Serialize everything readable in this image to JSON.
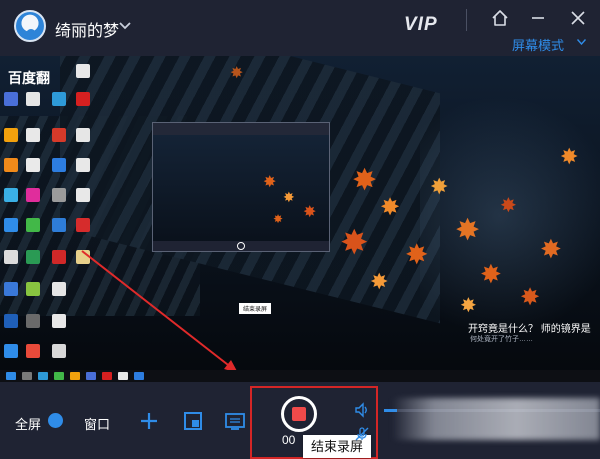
{
  "header": {
    "username": "绮丽的梦",
    "vip_label": "VIP",
    "mode_label": "屏幕模式"
  },
  "preview": {
    "desktop_text": "百度翻",
    "poem_line1": "开窍竟是什么？  师的镜界是",
    "poem_line2": "何处竟开了竹子……",
    "mini_tooltip": "结束录屏"
  },
  "controls": {
    "fullscreen_label": "全屏",
    "window_label": "窗口",
    "timer": "00",
    "stop_tooltip": "结束录屏",
    "volume_level": 0.06
  },
  "colors": {
    "accent": "#2f8ce8",
    "record": "#f04a4a",
    "highlight_frame": "#d42626",
    "background": "#1f2333"
  },
  "icons": [
    "avatar",
    "chevron-down-icon",
    "home-icon",
    "minimize-icon",
    "close-icon",
    "plus-icon",
    "region-select-icon",
    "video-icon",
    "record-stop-icon",
    "speaker-icon",
    "mic-muted-icon"
  ]
}
